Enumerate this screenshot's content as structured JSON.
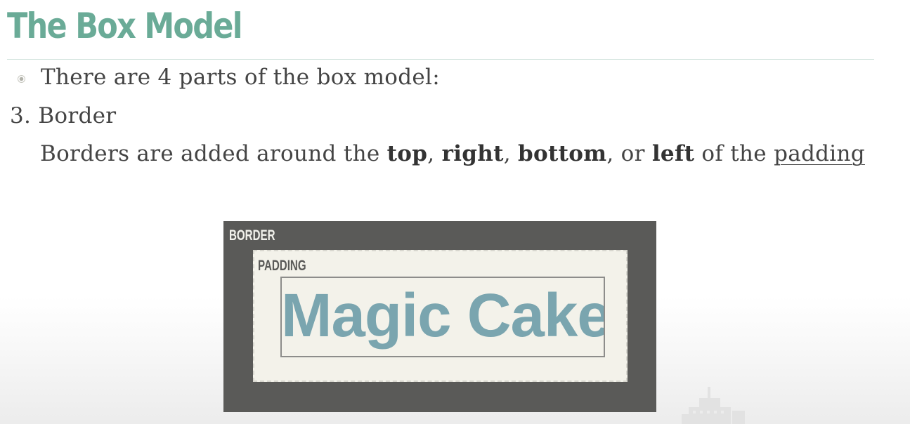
{
  "slide": {
    "title": "The Box Model",
    "bullet_text": "There are 4 parts of the box model:",
    "numbered_item": "3. Border",
    "description": {
      "prefix": "Borders are added around the ",
      "top": "top",
      "sep1": ", ",
      "right": "right",
      "sep2": ", ",
      "bottom": "bottom",
      "sep3": ", or ",
      "left": "left",
      "mid": " of the ",
      "padding": "padding"
    }
  },
  "diagram": {
    "border_label": "BORDER",
    "padding_label": "PADDING",
    "content_text": "Magic Cake"
  },
  "colors": {
    "title": "#6aab97",
    "body_text": "#444444",
    "border_fill": "#5a5a58",
    "padding_fill": "#f3f2ea",
    "content_text": "#7aa5af"
  }
}
